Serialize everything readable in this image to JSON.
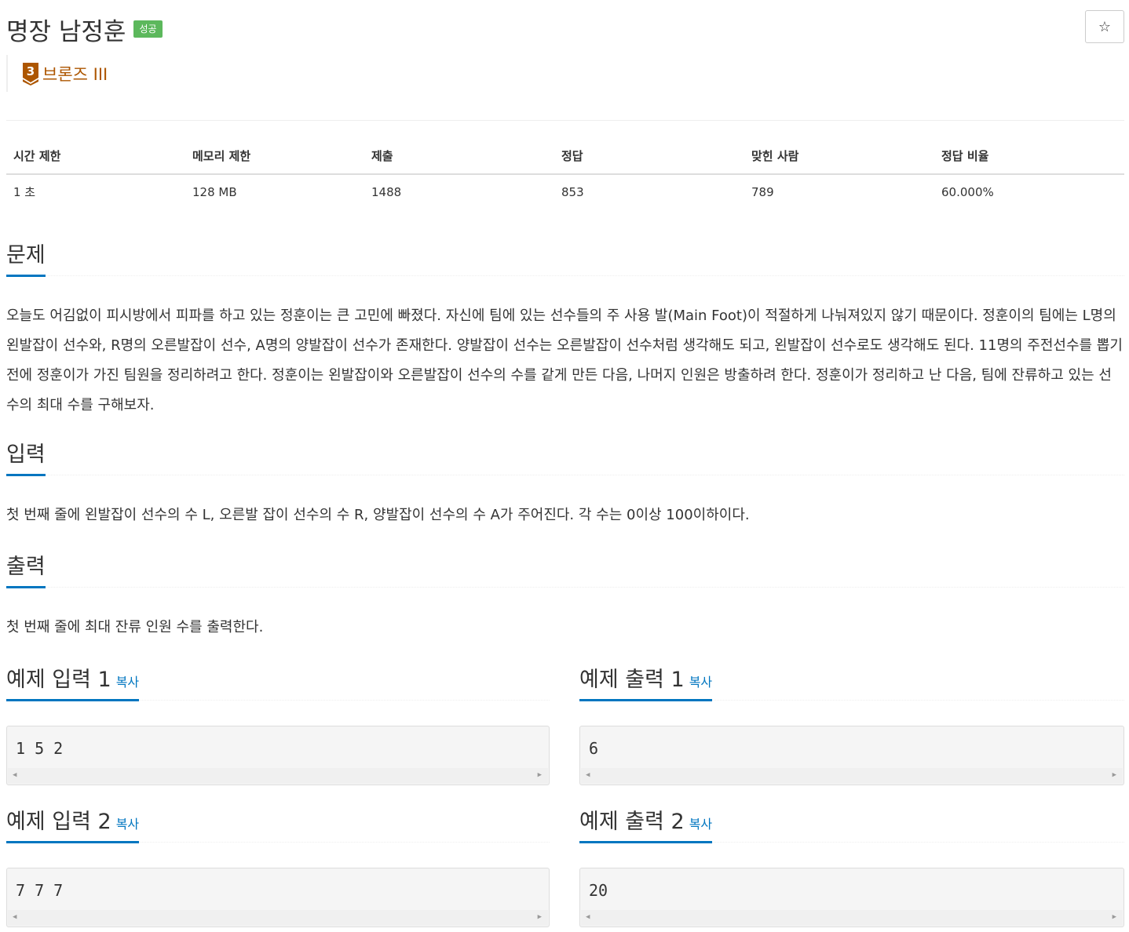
{
  "problem": {
    "title": "명장 남정훈",
    "status_badge": "성공",
    "star": "☆",
    "tier": {
      "number": "3",
      "label": "브론즈 III",
      "color": "#ad5600"
    }
  },
  "info_table": {
    "headers": [
      "시간 제한",
      "메모리 제한",
      "제출",
      "정답",
      "맞힌 사람",
      "정답 비율"
    ],
    "values": [
      "1 초",
      "128 MB",
      "1488",
      "853",
      "789",
      "60.000%"
    ]
  },
  "sections": {
    "problem": {
      "heading": "문제",
      "text": "오늘도 어김없이 피시방에서 피파를 하고 있는 정훈이는 큰 고민에 빠졌다. 자신에 팀에 있는 선수들의 주 사용 발(Main Foot)이 적절하게 나눠져있지 않기 때문이다. 정훈이의 팀에는 L명의 왼발잡이 선수와, R명의 오른발잡이 선수, A명의 양발잡이 선수가 존재한다. 양발잡이 선수는 오른발잡이 선수처럼 생각해도 되고, 왼발잡이 선수로도 생각해도 된다. 11명의 주전선수를 뽑기 전에 정훈이가 가진 팀원을 정리하려고 한다. 정훈이는 왼발잡이와 오른발잡이 선수의 수를 같게 만든 다음, 나머지 인원은 방출하려 한다. 정훈이가 정리하고 난 다음, 팀에 잔류하고 있는 선수의 최대 수를 구해보자."
    },
    "input": {
      "heading": "입력",
      "text": "첫 번째 줄에 왼발잡이 선수의 수 L, 오른발 잡이 선수의 수 R, 양발잡이 선수의 수 A가 주어진다. 각 수는 0이상 100이하이다."
    },
    "output": {
      "heading": "출력",
      "text": "첫 번째 줄에 최대 잔류 인원 수를 출력한다."
    }
  },
  "samples": [
    {
      "input_heading": "예제 입력 1",
      "output_heading": "예제 출력 1",
      "copy_label": "복사",
      "input": "1 5 2",
      "output": "6"
    },
    {
      "input_heading": "예제 입력 2",
      "output_heading": "예제 출력 2",
      "copy_label": "복사",
      "input": "7 7 7",
      "output": "20"
    }
  ],
  "colors": {
    "badge_success": "#5cb85c",
    "link_blue": "#0076c0",
    "bronze": "#ad5600"
  }
}
